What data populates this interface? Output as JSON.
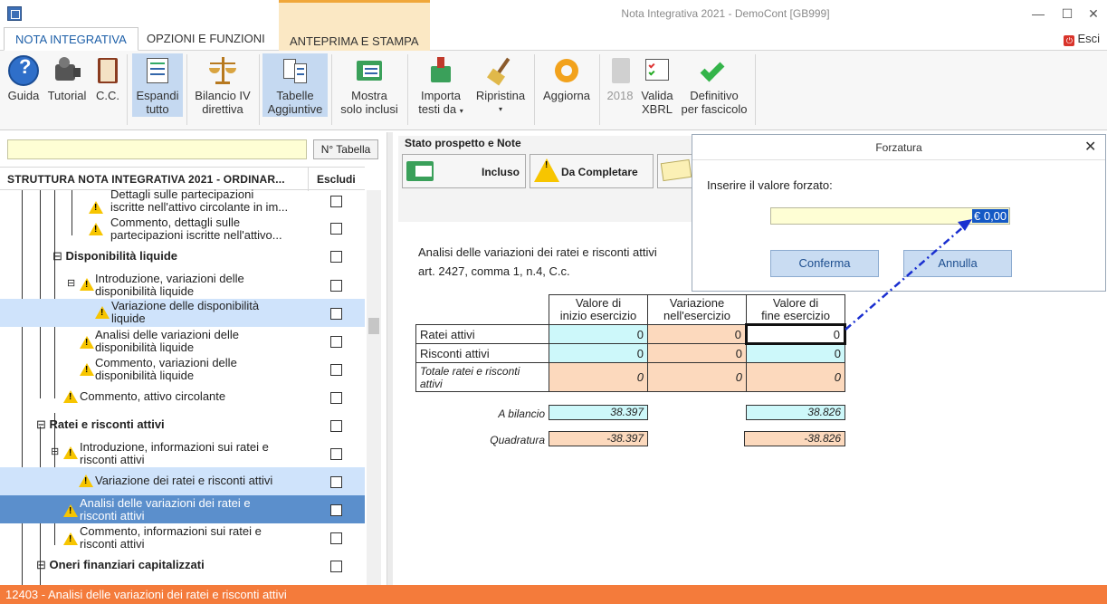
{
  "window": {
    "title": "Nota Integrativa 2021 - DemoCont [GB999]",
    "exit_label": "Esci"
  },
  "tabs": [
    "NOTA INTEGRATIVA",
    "OPZIONI E FUNZIONI",
    "ANTEPRIMA E STAMPA"
  ],
  "ribbon": {
    "guida": "Guida",
    "tutorial": "Tutorial",
    "cc": "C.C.",
    "espandi_1": "Espandi",
    "espandi_2": "tutto",
    "bilancio_1": "Bilancio IV",
    "bilancio_2": "direttiva",
    "tabelle_1": "Tabelle",
    "tabelle_2": "Aggiuntive",
    "mostra_1": "Mostra",
    "mostra_2": "solo inclusi",
    "importa_1": "Importa",
    "importa_2": "testi da",
    "ripristina": "Ripristina",
    "aggiorna": "Aggiorna",
    "y2018": "2018",
    "valida_1": "Valida",
    "valida_2": "XBRL",
    "definitivo_1": "Definitivo",
    "definitivo_2": "per fascicolo"
  },
  "left_panel": {
    "search_value": "",
    "ntabella_button": "N° Tabella",
    "header_title": "STRUTTURA NOTA INTEGRATIVA 2021 - ORDINAR...",
    "header_exclude": "Escludi",
    "rows": [
      {
        "l1": "Dettagli sulle partecipazioni",
        "l2": "iscritte nell'attivo circolante in im..."
      },
      {
        "l1": "Commento, dettagli sulle",
        "l2": "partecipazioni iscritte nell'attivo..."
      },
      {
        "l1": "Disponibilità liquide"
      },
      {
        "l1": "Introduzione, variazioni delle",
        "l2": "disponibilità liquide"
      },
      {
        "l1": "Variazione delle disponibilità",
        "l2": "liquide"
      },
      {
        "l1": "Analisi delle variazioni delle",
        "l2": "disponibilità liquide"
      },
      {
        "l1": "Commento, variazioni delle",
        "l2": "disponibilità liquide"
      },
      {
        "l1": "Commento, attivo circolante"
      },
      {
        "l1": "Ratei e risconti attivi"
      },
      {
        "l1": "Introduzione, informazioni sui ratei e",
        "l2": "risconti attivi"
      },
      {
        "l1": "Variazione dei ratei e risconti attivi"
      },
      {
        "l1": "Analisi delle variazioni dei ratei e",
        "l2": "risconti attivi"
      },
      {
        "l1": "Commento, informazioni sui ratei e",
        "l2": "risconti attivi"
      },
      {
        "l1": "Oneri finanziari capitalizzati"
      }
    ]
  },
  "status": {
    "title": "Stato prospetto e Note",
    "incluso": "Incluso",
    "da_completare": "Da Completare"
  },
  "content": {
    "analisi_line1": "Analisi delle variazioni dei ratei e risconti attivi",
    "analisi_line2": "art. 2427, comma 1, n.4, C.c.",
    "col1_l1": "Valore di",
    "col1_l2": "inizio esercizio",
    "col2_l1": "Variazione",
    "col2_l2": "nell'esercizio",
    "col3_l1": "Valore di",
    "col3_l2": "fine esercizio",
    "r1_label": "Ratei attivi",
    "r1_c1": "0",
    "r1_c2": "0",
    "r1_c3": "0",
    "r2_label": "Risconti attivi",
    "r2_c1": "0",
    "r2_c2": "0",
    "r2_c3": "0",
    "r3_label_1": "Totale ratei e risconti",
    "r3_label_2": "attivi",
    "r3_c1": "0",
    "r3_c2": "0",
    "r3_c3": "0",
    "bilancio_label": "A bilancio",
    "bilancio_start": "38.397",
    "bilancio_end": "38.826",
    "quadratura_label": "Quadratura",
    "quadratura_start": "-38.397",
    "quadratura_end": "-38.826"
  },
  "dialog": {
    "title": "Forzatura",
    "prompt": "Inserire il valore forzato:",
    "value": "€ 0,00",
    "confirm": "Conferma",
    "cancel": "Annulla"
  },
  "statusbar": "12403 - Analisi delle variazioni dei ratei e risconti attivi"
}
